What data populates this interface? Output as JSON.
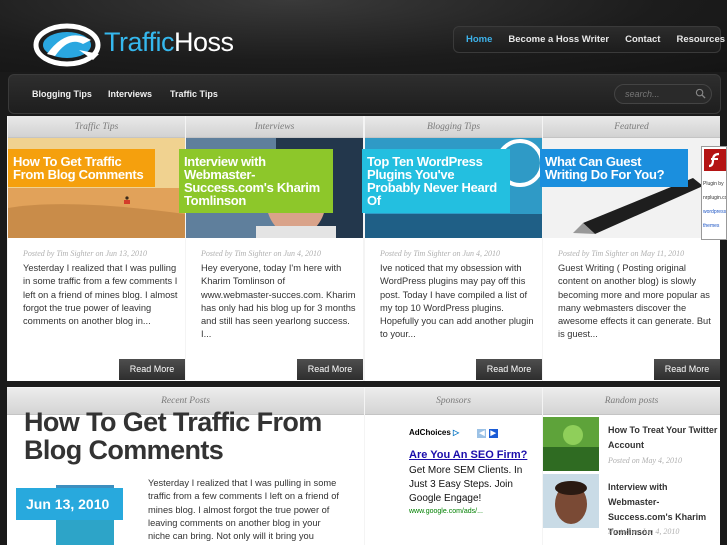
{
  "brand": {
    "name_part1": "Traffic",
    "name_part2": "Hoss"
  },
  "top_nav": {
    "items": [
      {
        "label": "Home",
        "active": true
      },
      {
        "label": "Become a Hoss Writer",
        "active": false
      },
      {
        "label": "Contact",
        "active": false
      },
      {
        "label": "Resources",
        "active": false
      }
    ]
  },
  "category_nav": {
    "items": [
      "Blogging Tips",
      "Interviews",
      "Traffic Tips"
    ]
  },
  "search": {
    "placeholder": "search..."
  },
  "featured_columns": [
    {
      "heading": "Traffic Tips",
      "banner": "How To Get Traffic From Blog Comments",
      "banner_color": "#f5a00d",
      "meta": "Posted by Tim Sighter on Jun 13, 2010",
      "excerpt": "Yesterday I realized that I was pulling in some traffic from a few comments I left on a friend of mines blog. I almost forgot the true power of leaving comments on another blog in...",
      "read_more": "Read More"
    },
    {
      "heading": "Interviews",
      "banner": "Interview with Webmaster-Success.com's Kharim Tomlinson",
      "banner_color": "#8dc72a",
      "meta": "Posted by Tim Sighter on Jun 4, 2010",
      "excerpt": "Hey everyone, today I'm here with Kharim Tomlinson of www.webmaster-succes.com. Kharim has only had his blog up for 3 months and still has seen yearlong success. I...",
      "read_more": "Read More"
    },
    {
      "heading": "Blogging Tips",
      "banner": "Top Ten WordPress Plugins You've Probably Never Heard Of",
      "banner_color": "#23bfe0",
      "meta": "Posted by Tim Sighter on Jun 4, 2010",
      "excerpt": "Ive noticed that my obsession with WordPress plugins may pay off this post. Today I have compiled a list of my top 10 WordPress plugins. Hopefully you can add another plugin to your...",
      "read_more": "Read More"
    },
    {
      "heading": "Featured",
      "banner": "What Can Guest Writing Do For You?",
      "banner_color": "#1b8fde",
      "meta": "Posted by Tim Sighter on May 11, 2010",
      "excerpt": "Guest Writing ( Posting original content on another blog) is slowly becoming more and more popular as many webmasters discover the awesome effects it can generate. But is guest...",
      "read_more": "Read More"
    }
  ],
  "flash_plugin": {
    "line1": "Plugin by",
    "line2": "nrplugin.co",
    "line3": "wordpress",
    "line4": "themes"
  },
  "recent_posts": {
    "heading": "Recent Posts",
    "title": "How To Get Traffic From Blog Comments",
    "date": "Jun 13, 2010",
    "excerpt": "Yesterday I realized that I was pulling in some traffic from a few comments I left on a friend of mines blog. I almost forgot the true power of leaving comments on another blog in your niche can bring. Not only will it bring you"
  },
  "sponsors": {
    "heading": "Sponsors",
    "ad_choices": "AdChoices",
    "ad_headline": "Are You An SEO Firm?",
    "ad_body": "Get More SEM Clients. In Just 3 Easy Steps. Join Google Engage!",
    "ad_url": "www.google.com/ads/..."
  },
  "random_posts": {
    "heading": "Random posts",
    "items": [
      {
        "title": "How To Treat Your Twitter Account",
        "meta": "Posted on May 4, 2010"
      },
      {
        "title": "Interview with Webmaster-Success.com's Kharim Tomlinson",
        "meta": "Posted on Jun 4, 2010"
      }
    ]
  }
}
